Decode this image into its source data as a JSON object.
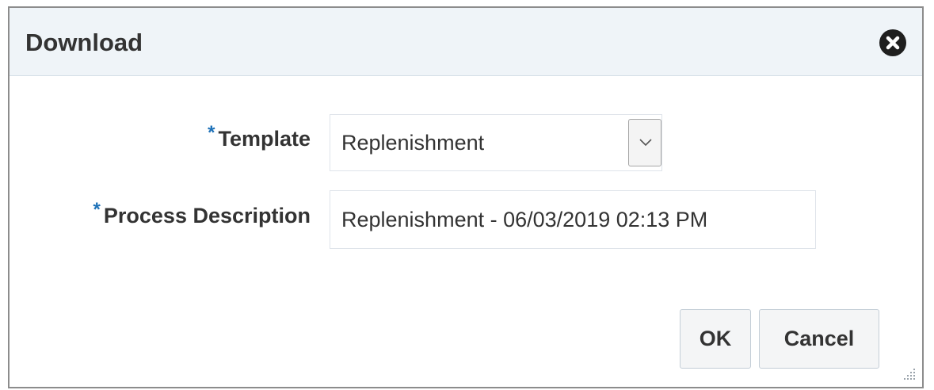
{
  "dialog": {
    "title": "Download",
    "close_icon": "close-circle-icon"
  },
  "form": {
    "template": {
      "required_marker": "*",
      "label": "Template",
      "selected_value": "Replenishment"
    },
    "process_description": {
      "required_marker": "*",
      "label": "Process Description",
      "value": "Replenishment - 06/03/2019 02:13 PM"
    }
  },
  "buttons": {
    "ok_label": "OK",
    "cancel_label": "Cancel"
  },
  "colors": {
    "header_bg": "#eff4f8",
    "required_marker": "#1d71b8",
    "button_bg": "#f4f5f6"
  }
}
